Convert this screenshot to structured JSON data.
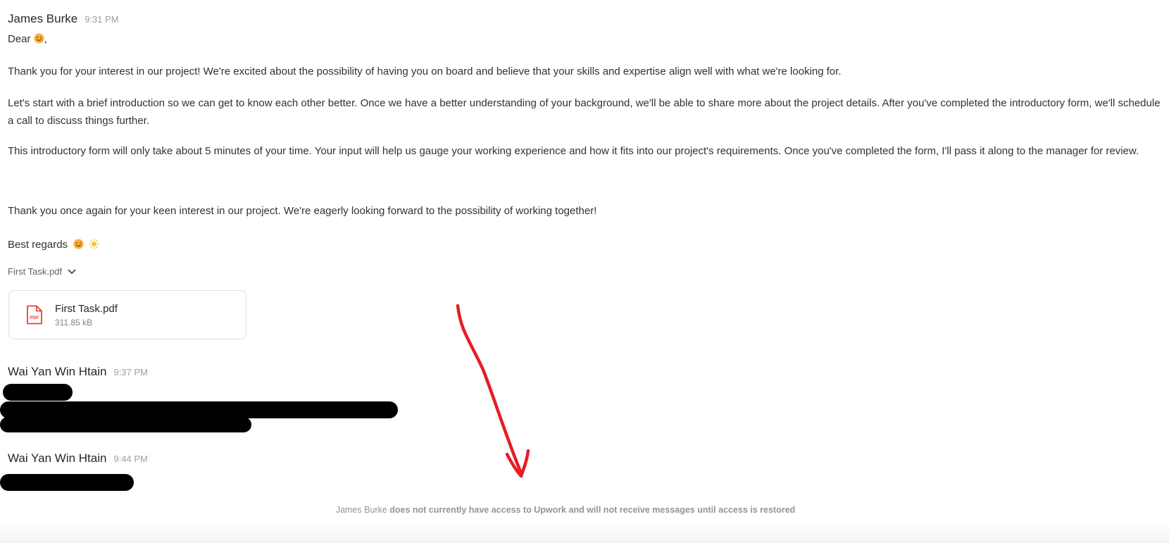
{
  "messages": [
    {
      "sender": "James Burke",
      "time": "9:31 PM",
      "greeting": "Dear",
      "greeting_suffix": ",",
      "paragraphs": [
        "Thank you for your interest in our project! We're excited about the possibility of having you on board and believe that your skills and expertise align well with what we're looking for.",
        "Let's start with a brief introduction so we can get to know each other better. Once we have a better understanding of your background, we'll be able to share more about the project details. After you've completed the introductory form, we'll schedule a call to discuss things further.",
        "This introductory form will only take about 5 minutes of your time. Your input will help us gauge your working experience and how it fits into our project's requirements. Once you've completed the form, I'll pass it along to the manager for review.",
        "Thank you once again for your keen interest in our project. We're eagerly looking forward to the possibility of working together!"
      ],
      "closing": "Best regards",
      "attachment_toggle": "First Task.pdf",
      "attachment": {
        "name": "First Task.pdf",
        "size": "311.85 kB",
        "icon_label": "PDF"
      }
    },
    {
      "sender": "Wai Yan Win Htain",
      "time": "9:37 PM"
    },
    {
      "sender": "Wai Yan Win Htain",
      "time": "9:44 PM"
    }
  ],
  "notice": {
    "name": "James Burke",
    "text": "does not currently have access to Upwork and will not receive messages until access is restored"
  },
  "icons": {
    "smile": "smiling-face-emoji",
    "sun": "sun-emoji",
    "chevron": "chevron-down-icon",
    "file": "pdf-file-icon"
  },
  "colors": {
    "text": "#1f2a1d",
    "muted": "#9aa39a",
    "pdf_red": "#e8432e",
    "arrow_red": "#e41e26"
  }
}
